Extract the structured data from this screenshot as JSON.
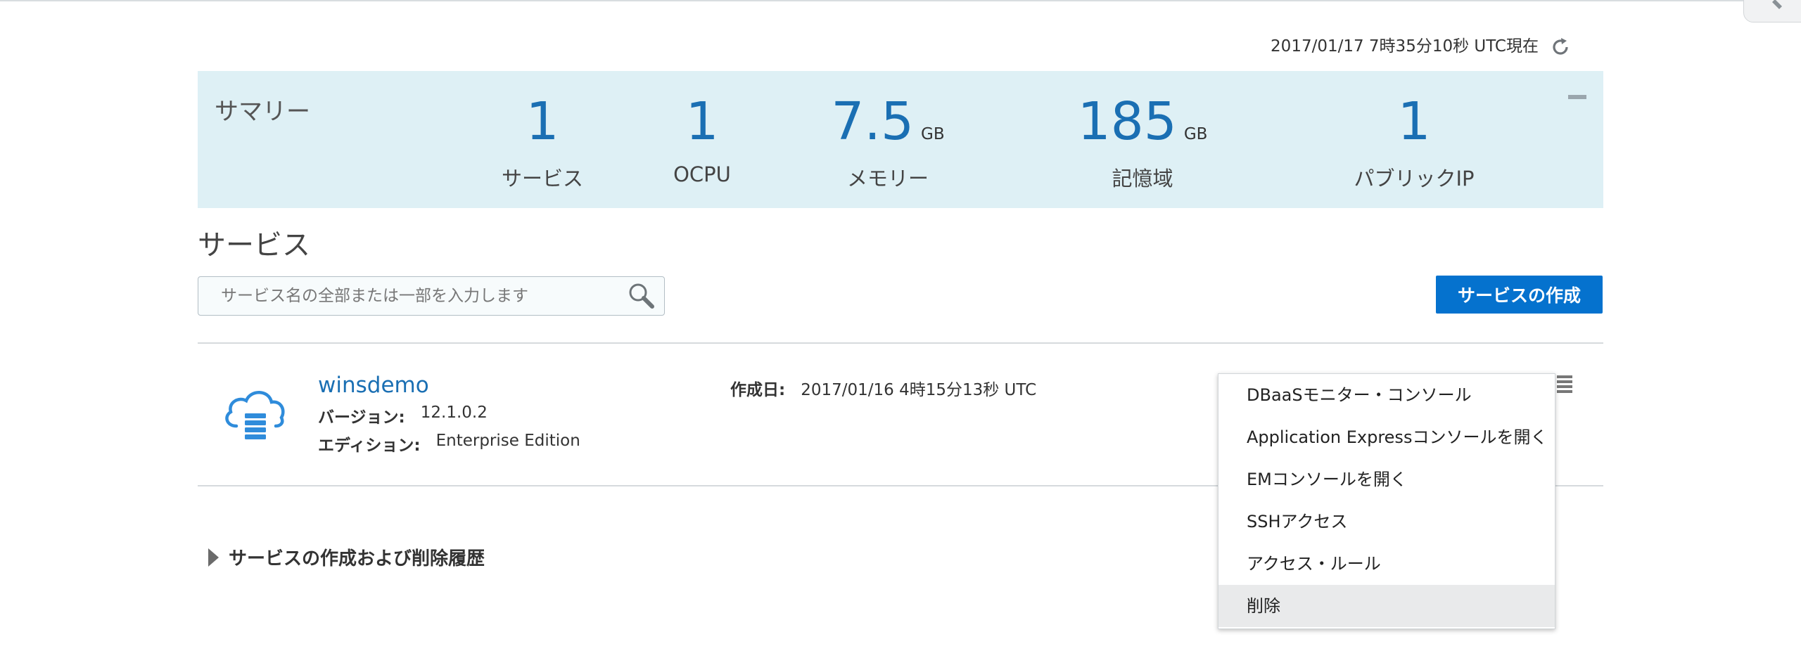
{
  "header": {
    "timestamp": "2017/01/17 7時35分10秒 UTC現在"
  },
  "summary": {
    "title": "サマリー",
    "metrics": [
      {
        "value": "1",
        "unit": "",
        "label": "サービス"
      },
      {
        "value": "1",
        "unit": "",
        "label": "OCPU"
      },
      {
        "value": "7.5",
        "unit": "GB",
        "label": "メモリー"
      },
      {
        "value": "185",
        "unit": "GB",
        "label": "記憶域"
      },
      {
        "value": "1",
        "unit": "",
        "label": "パブリックIP"
      }
    ]
  },
  "services": {
    "heading": "サービス",
    "search_placeholder": "サービス名の全部または一部を入力します",
    "create_button": "サービスの作成",
    "items": [
      {
        "name": "winsdemo",
        "version_label": "バージョン:",
        "version": "12.1.0.2",
        "edition_label": "エディション:",
        "edition": "Enterprise Edition",
        "created_label": "作成日:",
        "created": "2017/01/16 4時15分13秒 UTC"
      }
    ]
  },
  "menu": {
    "items": [
      "DBaaSモニター・コンソール",
      "Application Expressコンソールを開く",
      "EMコンソールを開く",
      "SSHアクセス",
      "アクセス・ルール",
      "削除"
    ]
  },
  "history": {
    "label": "サービスの作成および削除履歴"
  },
  "icons": {
    "refresh": "refresh-icon",
    "search": "search-icon",
    "service": "cloud-database-icon",
    "menu": "hamburger-menu-icon",
    "collapse": "minus-icon",
    "history_toggle": "triangle-right-icon",
    "corner": "pencil-icon"
  },
  "colors": {
    "accent": "#0572ce",
    "summary_bg": "#def0f5",
    "metric_text": "#1a6fb3",
    "link": "#1a6fb3",
    "menu_highlight": "#e9eaeb"
  }
}
